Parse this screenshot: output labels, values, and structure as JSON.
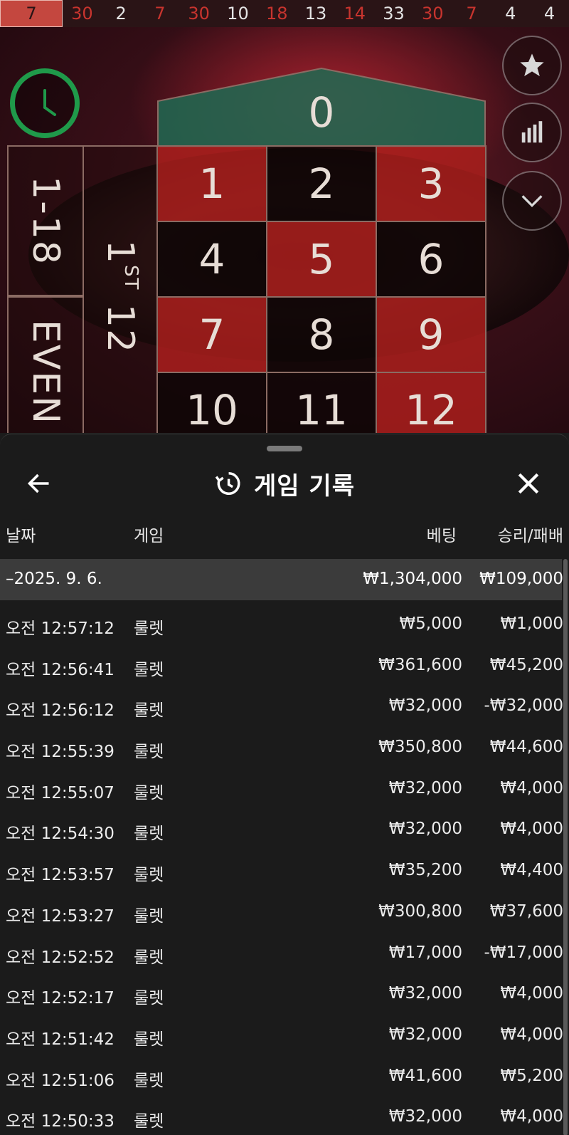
{
  "results": [
    {
      "n": "7",
      "color": "red",
      "latest": true
    },
    {
      "n": "30",
      "color": "red"
    },
    {
      "n": "2",
      "color": "black"
    },
    {
      "n": "7",
      "color": "red"
    },
    {
      "n": "30",
      "color": "red"
    },
    {
      "n": "10",
      "color": "black"
    },
    {
      "n": "18",
      "color": "red"
    },
    {
      "n": "13",
      "color": "black"
    },
    {
      "n": "14",
      "color": "red"
    },
    {
      "n": "33",
      "color": "black"
    },
    {
      "n": "30",
      "color": "red"
    },
    {
      "n": "7",
      "color": "red"
    },
    {
      "n": "4",
      "color": "black"
    },
    {
      "n": "4",
      "color": "black"
    }
  ],
  "table": {
    "zero": "0",
    "numbers": [
      {
        "n": "1",
        "color": "red"
      },
      {
        "n": "2",
        "color": "black"
      },
      {
        "n": "3",
        "color": "red"
      },
      {
        "n": "4",
        "color": "black"
      },
      {
        "n": "5",
        "color": "red"
      },
      {
        "n": "6",
        "color": "black"
      },
      {
        "n": "7",
        "color": "red"
      },
      {
        "n": "8",
        "color": "black"
      },
      {
        "n": "9",
        "color": "red"
      },
      {
        "n": "10",
        "color": "black"
      },
      {
        "n": "11",
        "color": "black"
      },
      {
        "n": "12",
        "color": "red"
      }
    ],
    "low_label": "1-18",
    "even_label": "EVEN",
    "dozen_number": "1",
    "dozen_suffix": "ST",
    "dozen_value": "12"
  },
  "side_icons": [
    "star-icon",
    "stats-icon",
    "chevron-down-icon"
  ],
  "panel": {
    "title": "게임 기록",
    "columns": {
      "date": "날짜",
      "game": "게임",
      "bet": "베팅",
      "result": "승리/패배"
    },
    "group": {
      "date": "–2025. 9. 6.",
      "bet": "₩1,304,000",
      "result": "₩109,000"
    },
    "rows": [
      {
        "time": "오전 12:57:12",
        "game": "룰렛",
        "bet": "₩5,000",
        "result": "₩1,000"
      },
      {
        "time": "오전 12:56:41",
        "game": "룰렛",
        "bet": "₩361,600",
        "result": "₩45,200"
      },
      {
        "time": "오전 12:56:12",
        "game": "룰렛",
        "bet": "₩32,000",
        "result": "-₩32,000"
      },
      {
        "time": "오전 12:55:39",
        "game": "룰렛",
        "bet": "₩350,800",
        "result": "₩44,600"
      },
      {
        "time": "오전 12:55:07",
        "game": "룰렛",
        "bet": "₩32,000",
        "result": "₩4,000"
      },
      {
        "time": "오전 12:54:30",
        "game": "룰렛",
        "bet": "₩32,000",
        "result": "₩4,000"
      },
      {
        "time": "오전 12:53:57",
        "game": "룰렛",
        "bet": "₩35,200",
        "result": "₩4,400"
      },
      {
        "time": "오전 12:53:27",
        "game": "룰렛",
        "bet": "₩300,800",
        "result": "₩37,600"
      },
      {
        "time": "오전 12:52:52",
        "game": "룰렛",
        "bet": "₩17,000",
        "result": "-₩17,000"
      },
      {
        "time": "오전 12:52:17",
        "game": "룰렛",
        "bet": "₩32,000",
        "result": "₩4,000"
      },
      {
        "time": "오전 12:51:42",
        "game": "룰렛",
        "bet": "₩32,000",
        "result": "₩4,000"
      },
      {
        "time": "오전 12:51:06",
        "game": "룰렛",
        "bet": "₩41,600",
        "result": "₩5,200"
      },
      {
        "time": "오전 12:50:33",
        "game": "룰렛",
        "bet": "₩32,000",
        "result": "₩4,000"
      }
    ]
  },
  "colors": {
    "red": "#c8342e",
    "timer_green": "#1f9a4a",
    "zero_green": "#1e6a52",
    "panel_bg": "#1b1b1b",
    "group_bg": "#3b3b3b"
  }
}
